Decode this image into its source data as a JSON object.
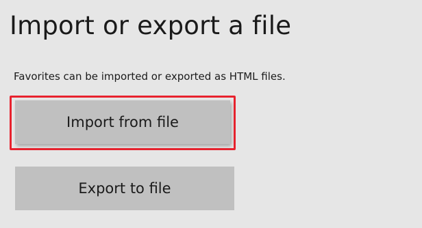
{
  "title": "Import or export a file",
  "description": "Favorites can be imported or exported as HTML files.",
  "buttons": {
    "import_label": "Import from file",
    "export_label": "Export to file"
  },
  "colors": {
    "background": "#e6e6e6",
    "button": "#c0c0c0",
    "highlight": "#e8222e",
    "text": "#1a1a1a"
  }
}
